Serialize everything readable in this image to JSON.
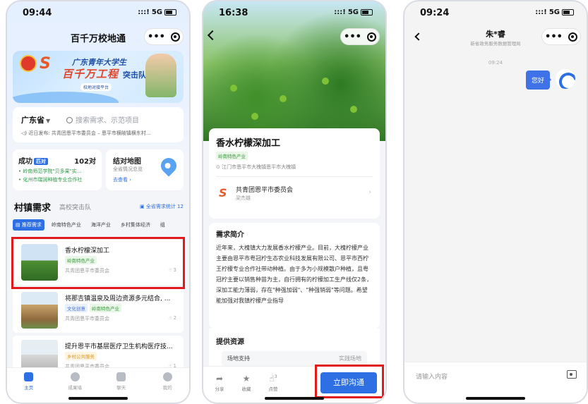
{
  "phone1": {
    "time": "09:44",
    "signal": "5G",
    "title": "百千万校地通",
    "banner": {
      "line1": "广东青年大学生",
      "line2": "百千万工程",
      "line3": "突击队",
      "line4": "校地对接平台"
    },
    "search": {
      "province": "广东省",
      "placeholder": "搜索需求、示范项目",
      "notice": "近日发布: 共青团恩平市委员会 – 恩平市横陂镇横东村..."
    },
    "success": {
      "title": "成功",
      "tag": "匹对",
      "count": "102对",
      "line1": "• 岭南师范学院\"贝多果\"实...",
      "line2": "• 化州市瑞润种植专业合作社"
    },
    "map": {
      "title": "结对地图",
      "subtitle": "全省情况总览",
      "link": "去查看 ›"
    },
    "section": {
      "title": "村镇需求",
      "subtitle": "高校突击队",
      "right": "全省需求统计 12"
    },
    "tabs": [
      "推荐需求",
      "岭南特色产业",
      "海洋产业",
      "乡村集体经济",
      "组"
    ],
    "items": [
      {
        "title": "香水柠檬深加工",
        "tags": [
          "岭南特色产业"
        ],
        "org": "共青团恩平市委员会",
        "likes": "3"
      },
      {
        "title": "将那吉镇温泉及周边资源多元结合, ...",
        "tags": [
          "文化创意",
          "岭南特色产业"
        ],
        "org": "共青团恩平市委员会",
        "likes": "2"
      },
      {
        "title": "提升恩平市基层医疗卫生机构医疗技...",
        "tags": [
          "乡村公共服务"
        ],
        "org": "共青团恩平市委员会",
        "likes": "1"
      }
    ],
    "tabbar": [
      "主页",
      "成果墙",
      "聊天",
      "我的"
    ]
  },
  "phone2": {
    "time": "16:38",
    "signal": "5G",
    "title": "香水柠檬深加工",
    "tag": "岭南特色产业",
    "address": "江门市恩平市大槐镇恩平市大槐镇",
    "org": {
      "name": "共青团恩平市委员会",
      "person": "梁杰雄"
    },
    "desc_heading": "需求简介",
    "desc": "近年来，大槐镇大力发展香水柠檬产业。目前，大槐柠檬产业主要由恩平市粤冠柠生态农业科技发展有限公司、恩平市西柠王柠檬专业合作社带动种植。由于多为小规模散户种植，且粤冠柠主要以销售种苗为主，自行拥有的柠檬加工生产线仅2条，深加工能力薄弱，存在\"种强加弱\"、\"种强销弱\"等问题。希望能加强对我镇柠檬产业指导",
    "resources_heading": "提供资源",
    "resource": {
      "key": "场地支持",
      "value": "实践场地"
    },
    "actions": [
      "分享",
      "收藏",
      "点赞"
    ],
    "like_count": "3",
    "cta": "立即沟通"
  },
  "phone3": {
    "time": "09:24",
    "signal": "5G",
    "contact_name": "朱*睿",
    "contact_sub": "新省政务服务数据管理局",
    "msg_time": "09:24",
    "message": "您好",
    "input_placeholder": "请输入内容"
  }
}
